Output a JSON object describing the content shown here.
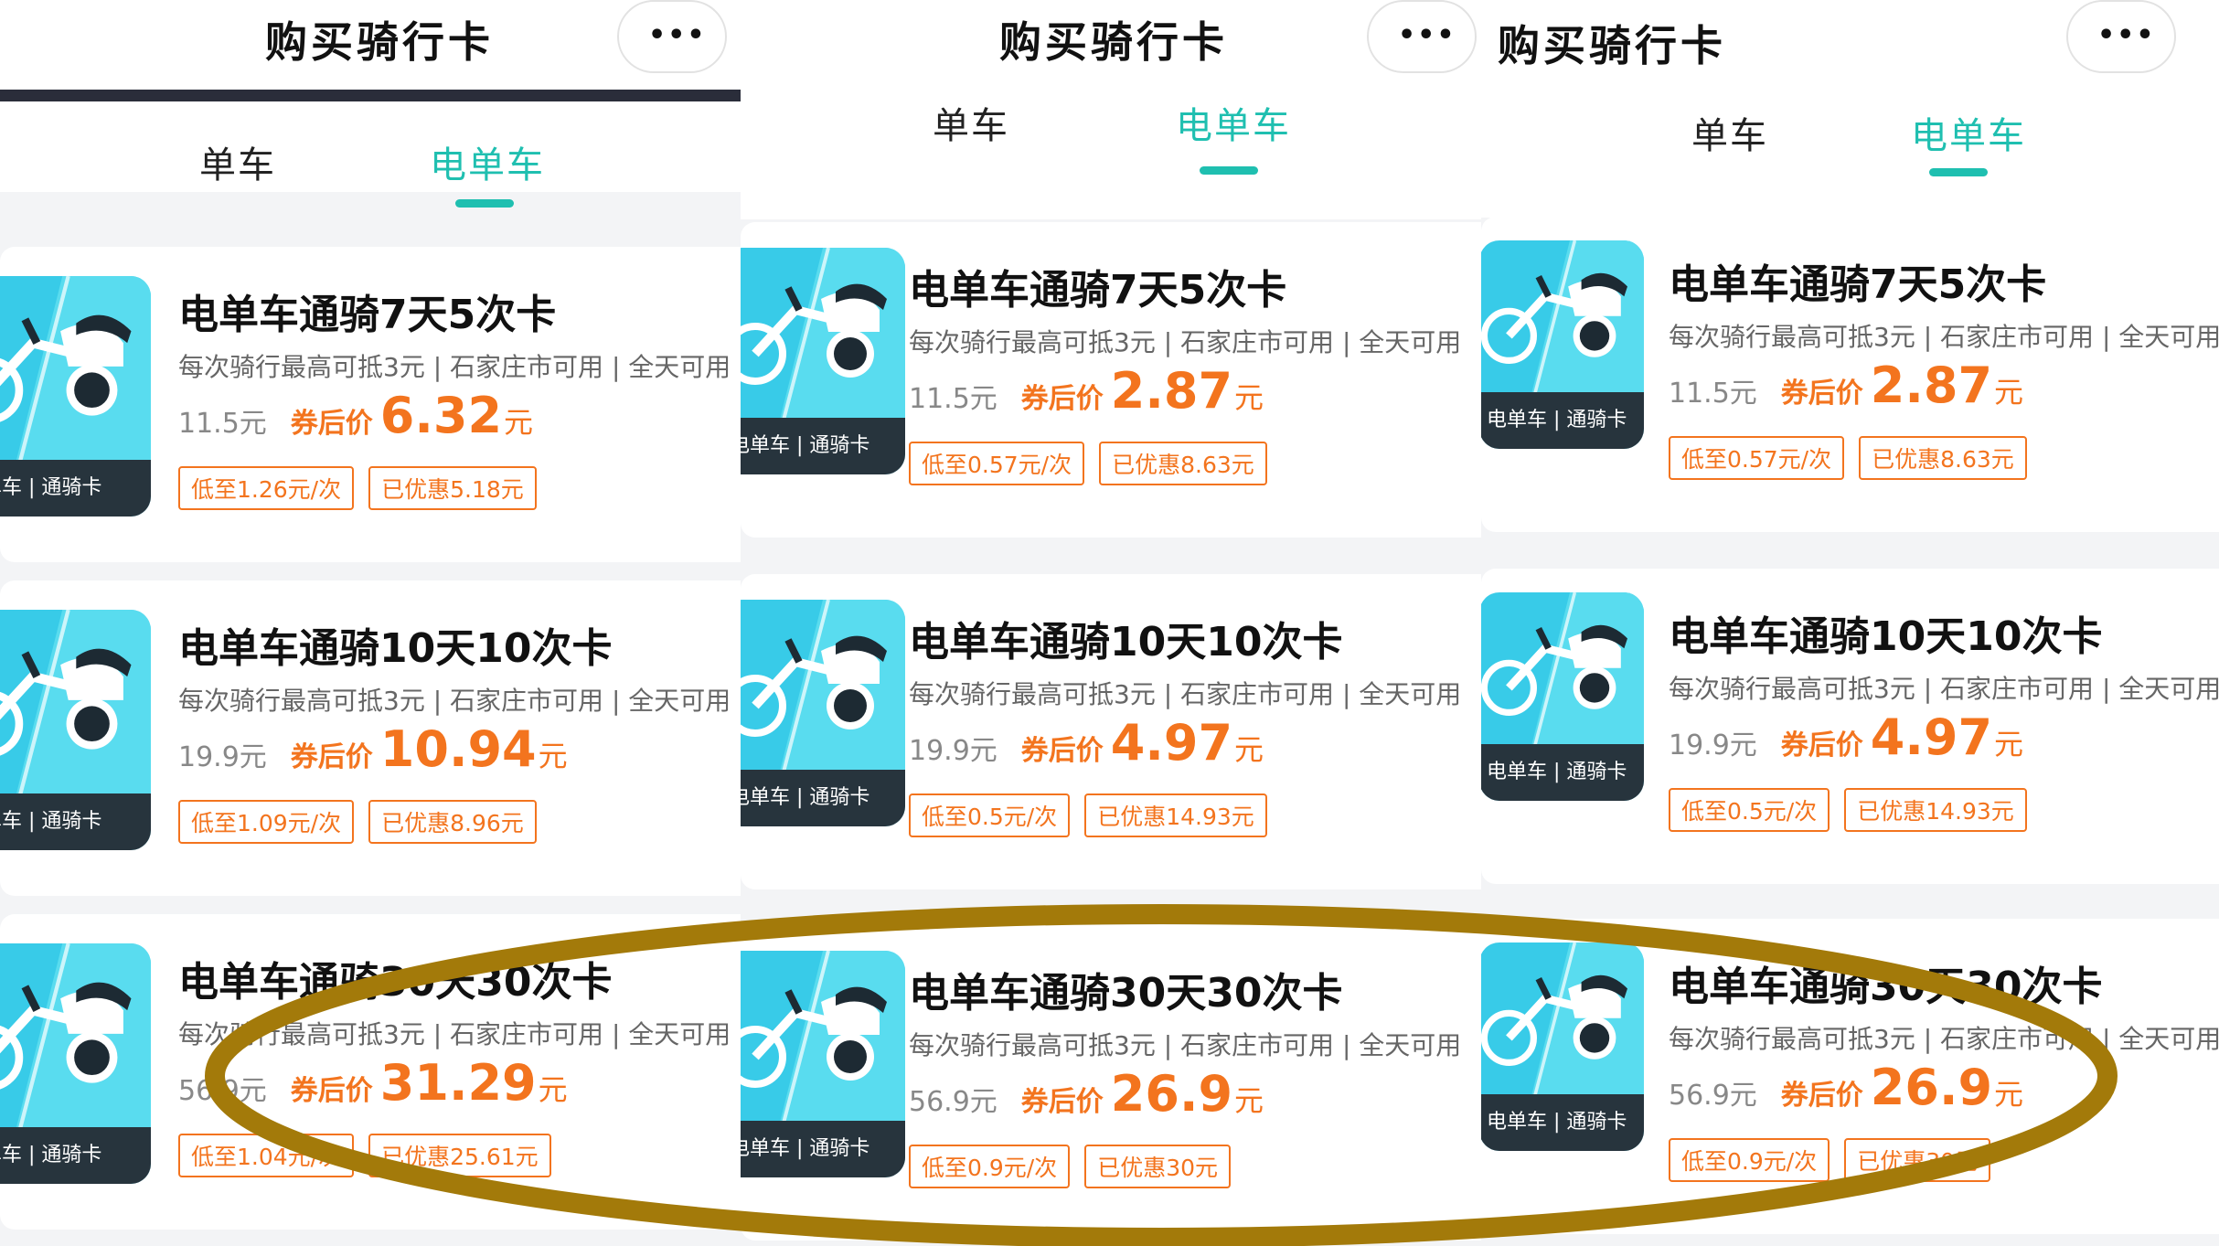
{
  "panels": [
    {
      "nav_title": "购买骑行卡",
      "more": "•••",
      "tabs": [
        {
          "label": "单车",
          "active": false
        },
        {
          "label": "电单车",
          "active": true
        }
      ],
      "cards": [
        {
          "thumb_label": "电单车 | 通骑卡",
          "title": "电单车通骑7天5次卡",
          "desc": "每次骑行最高可抵3元 | 石家庄市可用 | 全天可用",
          "original": "11.5元",
          "after_label": "券后价",
          "after_value": "6.32",
          "unit": "元",
          "tags": [
            "低至1.26元/次",
            "已优惠5.18元"
          ]
        },
        {
          "thumb_label": "电单车 | 通骑卡",
          "title": "电单车通骑10天10次卡",
          "desc": "每次骑行最高可抵3元 | 石家庄市可用 | 全天可用",
          "original": "19.9元",
          "after_label": "券后价",
          "after_value": "10.94",
          "unit": "元",
          "tags": [
            "低至1.09元/次",
            "已优惠8.96元"
          ]
        },
        {
          "thumb_label": "电单车 | 通骑卡",
          "title": "电单车通骑30天30次卡",
          "desc": "每次骑行最高可抵3元 | 石家庄市可用 | 全天可用",
          "original": "56.9元",
          "after_label": "券后价",
          "after_value": "31.29",
          "unit": "元",
          "tags": [
            "低至1.04元/次",
            "已优惠25.61元"
          ]
        }
      ]
    },
    {
      "nav_title": "购买骑行卡",
      "more": "•••",
      "tabs": [
        {
          "label": "单车",
          "active": false
        },
        {
          "label": "电单车",
          "active": true
        }
      ],
      "cards": [
        {
          "thumb_label": "电单车 | 通骑卡",
          "title": "电单车通骑7天5次卡",
          "desc": "每次骑行最高可抵3元 | 石家庄市可用 | 全天可用",
          "original": "11.5元",
          "after_label": "券后价",
          "after_value": "2.87",
          "unit": "元",
          "tags": [
            "低至0.57元/次",
            "已优惠8.63元"
          ]
        },
        {
          "thumb_label": "电单车 | 通骑卡",
          "title": "电单车通骑10天10次卡",
          "desc": "每次骑行最高可抵3元 | 石家庄市可用 | 全天可用",
          "original": "19.9元",
          "after_label": "券后价",
          "after_value": "4.97",
          "unit": "元",
          "tags": [
            "低至0.5元/次",
            "已优惠14.93元"
          ]
        },
        {
          "thumb_label": "电单车 | 通骑卡",
          "title": "电单车通骑30天30次卡",
          "desc": "每次骑行最高可抵3元 | 石家庄市可用 | 全天可用",
          "original": "56.9元",
          "after_label": "券后价",
          "after_value": "26.9",
          "unit": "元",
          "tags": [
            "低至0.9元/次",
            "已优惠30元"
          ]
        }
      ]
    },
    {
      "nav_title": "购买骑行卡",
      "more": "•••",
      "tabs": [
        {
          "label": "单车",
          "active": false
        },
        {
          "label": "电单车",
          "active": true
        }
      ],
      "cards": [
        {
          "thumb_label": "电单车 | 通骑卡",
          "title": "电单车通骑7天5次卡",
          "desc": "每次骑行最高可抵3元 | 石家庄市可用 | 全天可用",
          "original": "11.5元",
          "after_label": "券后价",
          "after_value": "2.87",
          "unit": "元",
          "tags": [
            "低至0.57元/次",
            "已优惠8.63元"
          ]
        },
        {
          "thumb_label": "电单车 | 通骑卡",
          "title": "电单车通骑10天10次卡",
          "desc": "每次骑行最高可抵3元 | 石家庄市可用 | 全天可用",
          "original": "19.9元",
          "after_label": "券后价",
          "after_value": "4.97",
          "unit": "元",
          "tags": [
            "低至0.5元/次",
            "已优惠14.93元"
          ]
        },
        {
          "thumb_label": "电单车 | 通骑卡",
          "title": "电单车通骑30天30次卡",
          "desc": "每次骑行最高可抵3元 | 石家庄市可用 | 全天可用",
          "original": "56.9元",
          "after_label": "券后价",
          "after_value": "26.9",
          "unit": "元",
          "tags": [
            "低至0.9元/次",
            "已优惠30元"
          ]
        }
      ]
    }
  ],
  "colors": {
    "accent": "#1fbfb0",
    "price": "#f3741e",
    "thumb_bg": "#38cbe8",
    "thumb_label_bg": "#27343d",
    "highlight": "#a37a0a"
  }
}
